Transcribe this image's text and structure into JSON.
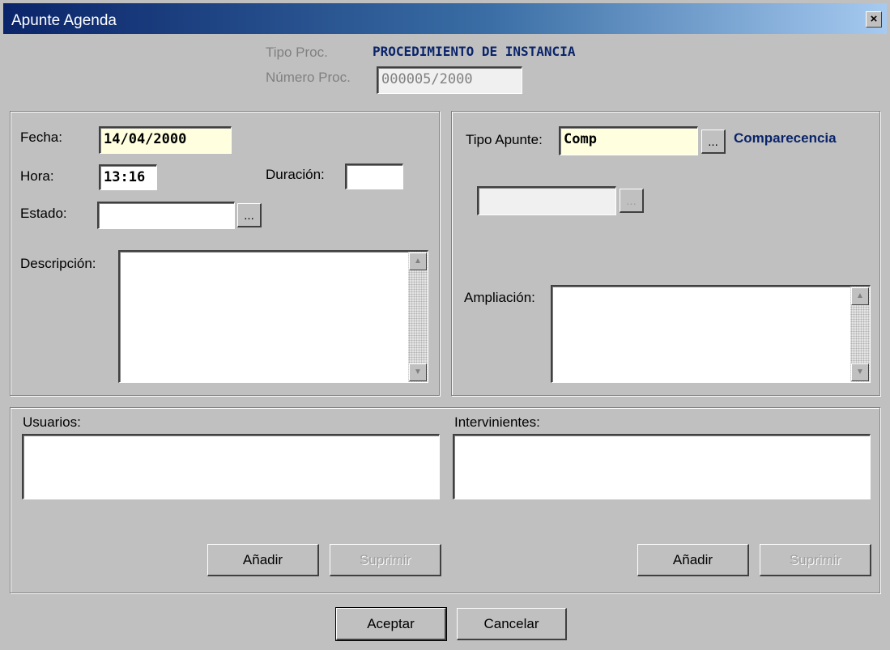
{
  "window": {
    "title": "Apunte Agenda",
    "close_glyph": "×"
  },
  "header": {
    "tipo_proc_label": "Tipo Proc.",
    "tipo_proc_value": "PROCEDIMIENTO DE  INSTANCIA",
    "numero_proc_label": "Número Proc.",
    "numero_proc_value": "000005/2000"
  },
  "left": {
    "fecha_label": "Fecha:",
    "fecha_value": "14/04/2000",
    "hora_label": "Hora:",
    "hora_value": "13:16",
    "duracion_label": "Duración:",
    "duracion_value": "",
    "estado_label": "Estado:",
    "estado_value": "",
    "estado_button": "...",
    "descripcion_label": "Descripción:"
  },
  "right": {
    "tipo_apunte_label": "Tipo Apunte:",
    "tipo_apunte_value": "Comp",
    "tipo_apunte_button": "...",
    "tipo_apunte_desc": "Comparecencia",
    "extra_button": "...",
    "ampliacion_label": "Ampliación:"
  },
  "bottom": {
    "usuarios_label": "Usuarios:",
    "intervinientes_label": "Intervinientes:",
    "usuarios_add": "Añadir",
    "usuarios_remove": "Suprimir",
    "intervinientes_add": "Añadir",
    "intervinientes_remove": "Suprimir"
  },
  "footer": {
    "accept": "Aceptar",
    "cancel": "Cancelar"
  },
  "icons": {
    "scroll_up": "▲",
    "scroll_down": "▼"
  },
  "colors": {
    "title_start": "#0a246a",
    "title_end": "#a6caf0",
    "accent": "#0a246a",
    "dialog": "#c0c0c0",
    "highlight_field": "#ffffe0"
  }
}
